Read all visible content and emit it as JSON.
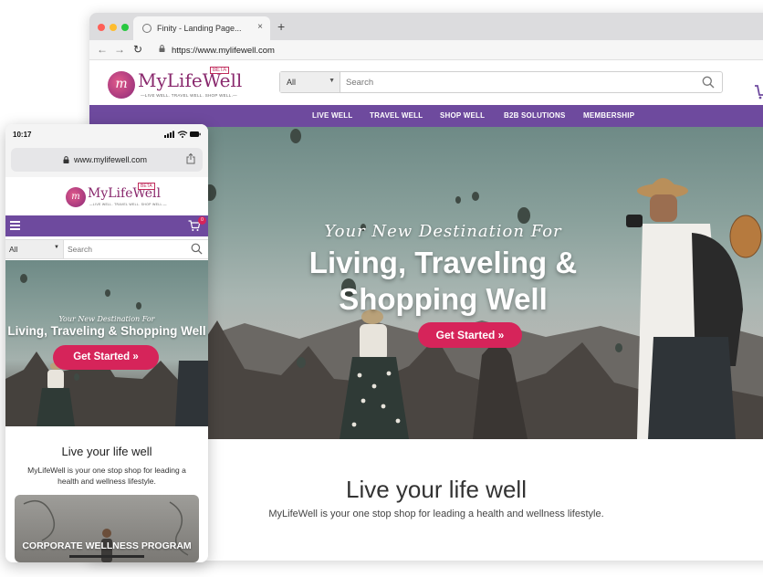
{
  "desktop": {
    "browser": {
      "tab_title": "Finity - Landing Page...",
      "tab_close": "×",
      "new_tab": "+",
      "url": "https://www.mylifewell.com"
    },
    "header": {
      "logo_letter": "m",
      "logo_word": "MyLifeWell",
      "logo_beta": "BETA",
      "logo_tagline": "—LIVE WELL. TRAVEL WELL. SHOP WELL.—",
      "search_category": "All",
      "search_placeholder": "Search"
    },
    "nav": [
      "LIVE WELL",
      "TRAVEL WELL",
      "SHOP WELL",
      "B2B SOLUTIONS",
      "MEMBERSHIP"
    ],
    "hero": {
      "tagline": "Your New Destination For",
      "headline_line1": "Living, Traveling &",
      "headline_line2": "Shopping Well",
      "cta": "Get Started »"
    },
    "intro": {
      "title": "Live your life well",
      "body": "MyLifeWell is your one stop shop for leading a health and wellness lifestyle."
    }
  },
  "mobile": {
    "status_time": "10:17",
    "url": "www.mylifewell.com",
    "header": {
      "logo_letter": "m",
      "logo_word": "MyLifeWell",
      "logo_beta": "BETA",
      "logo_tagline": "—LIVE WELL. TRAVEL WELL. SHOP WELL.—"
    },
    "cart_count": "0",
    "search_category": "All",
    "search_placeholder": "Search",
    "hero": {
      "tagline": "Your New Destination For",
      "headline": "Living, Traveling & Shopping Well",
      "cta": "Get Started »"
    },
    "intro": {
      "title": "Live your life well",
      "body": "MyLifeWell is your one stop shop for leading a health and wellness lifestyle."
    },
    "card_label": "CORPORATE WELLNESS PROGRAM"
  },
  "colors": {
    "brand_purple": "#6e4a9e",
    "cta_pink": "#d6245a",
    "logo_magenta": "#8a2a6e"
  }
}
